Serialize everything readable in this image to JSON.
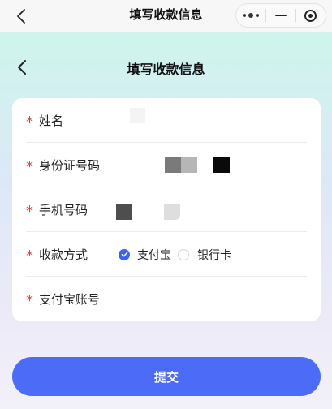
{
  "system_bar": {
    "title": "填写收款信息",
    "back_icon": "chevron-left-icon",
    "capsule": {
      "more_icon": "more-dots-icon",
      "minimize_icon": "minus-icon",
      "close_icon": "target-circle-icon"
    }
  },
  "header": {
    "title": "填写收款信息",
    "back_icon": "chevron-left-icon"
  },
  "form": {
    "required_mark": "*",
    "fields": [
      {
        "label": "姓名"
      },
      {
        "label": "身份证号码"
      },
      {
        "label": "手机号码"
      },
      {
        "label": "收款方式"
      },
      {
        "label": "支付宝账号"
      }
    ],
    "payment_method": {
      "options": [
        {
          "label": "支付宝",
          "selected": true
        },
        {
          "label": "银行卡",
          "selected": false
        }
      ]
    }
  },
  "submit": {
    "label": "提交"
  },
  "colors": {
    "accent": "#3a63f0",
    "button": "#4c6cf7",
    "required": "#e8443a"
  }
}
